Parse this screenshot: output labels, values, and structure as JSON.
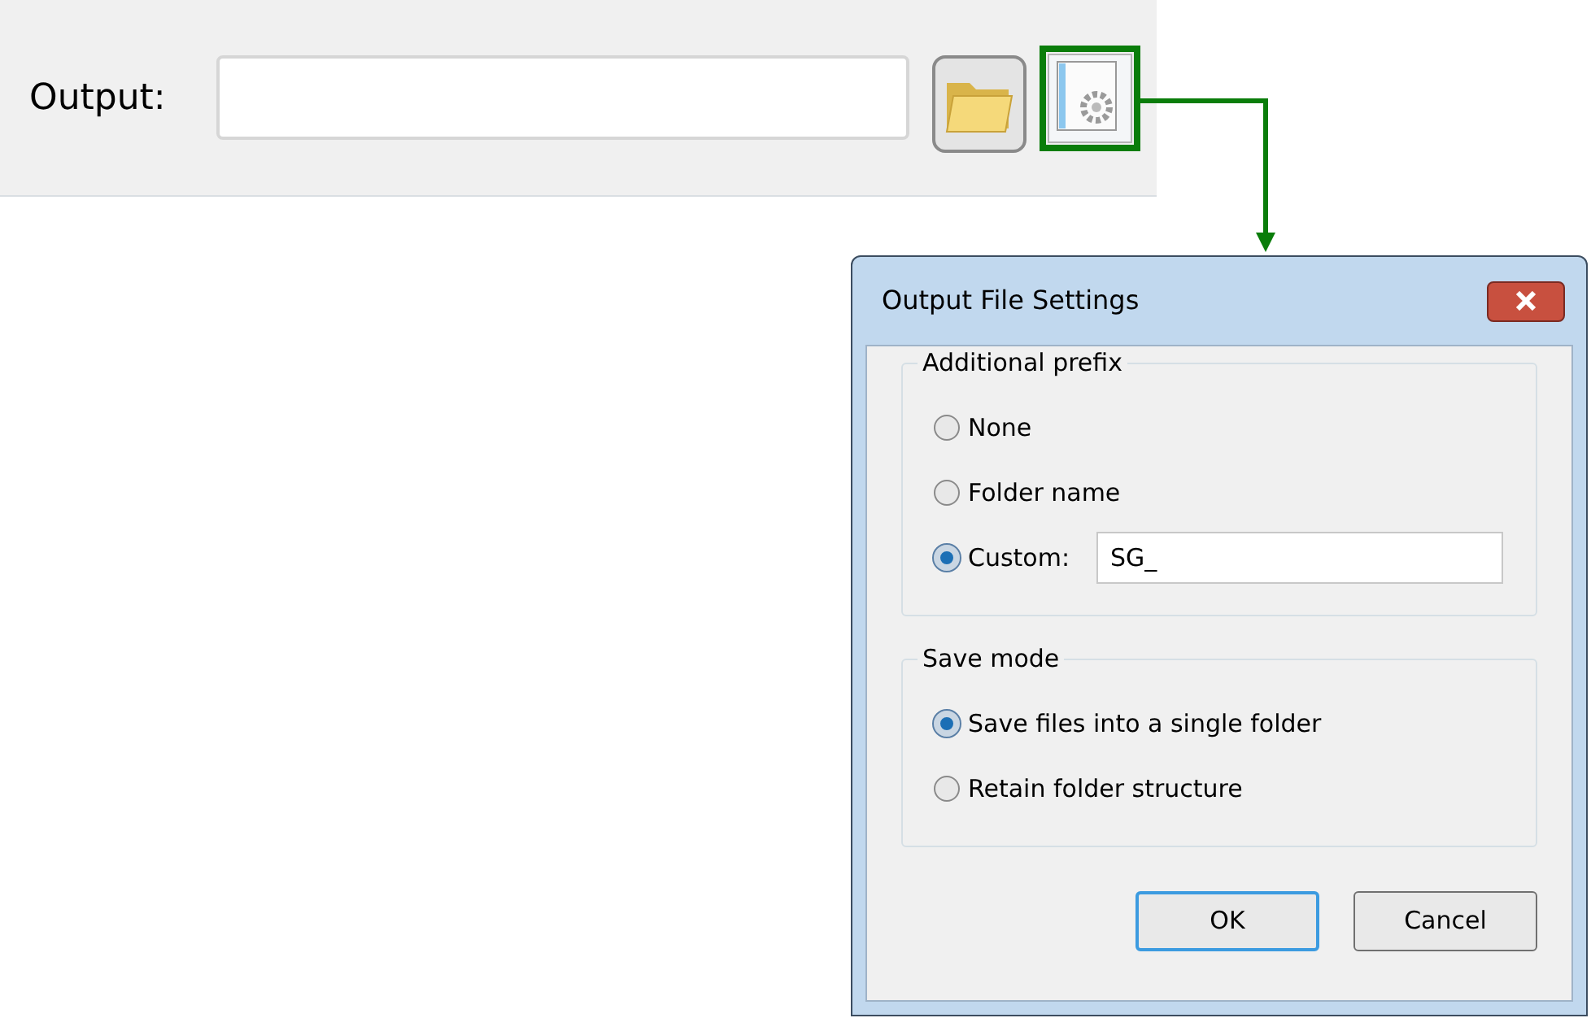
{
  "output_panel": {
    "label": "Output:",
    "settings_button": {
      "highlighted": true
    }
  },
  "dialog": {
    "title": "Output File Settings",
    "groups": [
      {
        "title": "Additional prefix",
        "options": [
          {
            "label": "None",
            "selected": false
          },
          {
            "label": "Folder name",
            "selected": false
          },
          {
            "label": "Custom:",
            "selected": true,
            "input_value": "SG_"
          }
        ]
      },
      {
        "title": "Save mode",
        "options": [
          {
            "label": "Save files into a single folder",
            "selected": true
          },
          {
            "label": "Retain folder structure",
            "selected": false
          }
        ]
      }
    ],
    "buttons": [
      {
        "label": "OK",
        "default": true
      },
      {
        "label": "Cancel",
        "default": false
      }
    ]
  }
}
